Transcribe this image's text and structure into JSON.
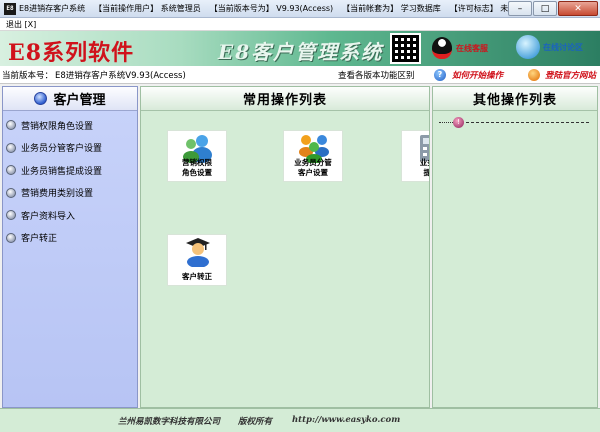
{
  "window": {
    "app_icon": "E8",
    "title_segments": [
      "E8进销存客户系统",
      "【当前操作用户】 系统管理员",
      "【当前版本号为】 V9.93(Access)",
      "【当前帐套为】 学习数据库",
      "【许可标志】 未注册版"
    ],
    "min_icon": "minimize-icon",
    "max_icon": "maximize-icon",
    "close_icon": "close-icon"
  },
  "menu": {
    "exit_label": "退出 [X]"
  },
  "banner": {
    "logo": "E8系列软件",
    "title": "E8客户管理系统",
    "qq_label": "在线客服",
    "chat_label": "在线讨论区"
  },
  "versionbar": {
    "label": "当前版本号：",
    "value": "E8进销存客户系统V9.93(Access)",
    "features_link": "查看各版本功能区别",
    "howto_link": "如何开始操作",
    "website_link": "登陆官方网站"
  },
  "left_panel": {
    "title": "客户管理",
    "items": [
      {
        "label": "营销权限角色设置"
      },
      {
        "label": "业务员分管客户设置"
      },
      {
        "label": "业务员销售提成设置"
      },
      {
        "label": "营销费用类别设置"
      },
      {
        "label": "客户资料导入"
      },
      {
        "label": "客户转正"
      }
    ]
  },
  "center_panel": {
    "title": "常用操作列表",
    "tiles": [
      {
        "label": "营销权限\n角色设置"
      },
      {
        "label": "业务员分管\n客户设置"
      },
      {
        "label": "业务员\n提成"
      },
      {
        "label": "客户转正"
      }
    ]
  },
  "right_panel": {
    "title": "其他操作列表"
  },
  "footer": {
    "company": "兰州易凯数字科技有限公司",
    "rights": "版权所有",
    "url": "http://www.easyko.com"
  },
  "colors": {
    "left_panel_bg": "#c8d3fa",
    "center_panel_bg": "#d4ecd6",
    "banner_accent": "#2c7e62"
  }
}
